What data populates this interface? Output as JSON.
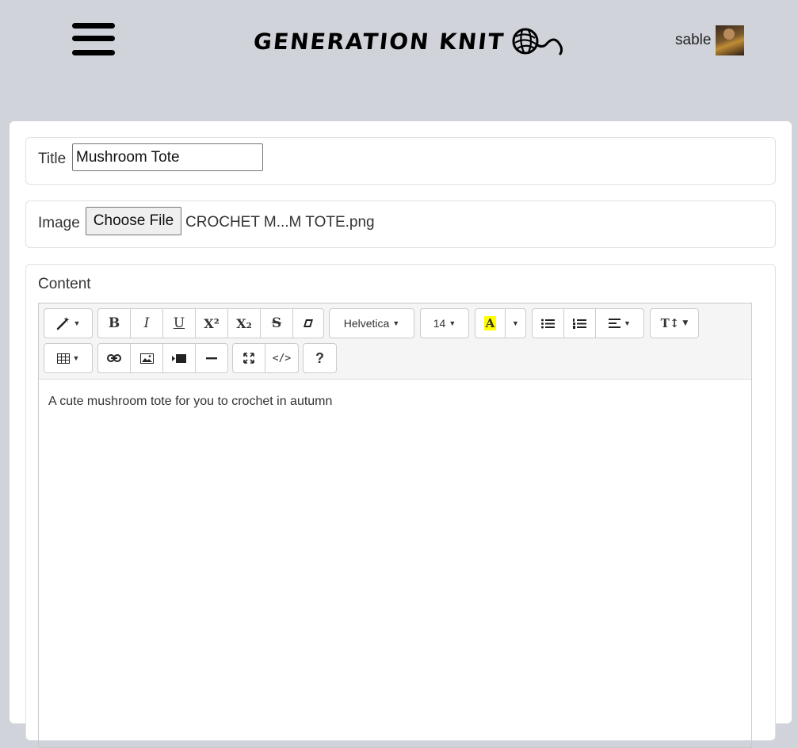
{
  "header": {
    "brand": "GENERATION KNIT",
    "username": "sable"
  },
  "form": {
    "title_label": "Title",
    "title_value": "Mushroom Tote",
    "image_label": "Image",
    "file_button_label": "Choose File",
    "file_name": "CROCHET M...M TOTE.png",
    "content_label": "Content"
  },
  "editor": {
    "toolbar": {
      "style_icon": "magic-wand-icon",
      "bold": "B",
      "italic": "I",
      "underline": "U",
      "superscript": "X²",
      "subscript": "X₂",
      "strikethrough": "S",
      "eraser_icon": "eraser-icon",
      "font_family": "Helvetica",
      "font_size": "14",
      "color_letter": "A",
      "help": "?",
      "code": "</>"
    },
    "body_text": "A cute mushroom tote for you to crochet in autumn"
  },
  "colors": {
    "page_bg": "#d0d4da",
    "highlight": "#ffff00"
  }
}
